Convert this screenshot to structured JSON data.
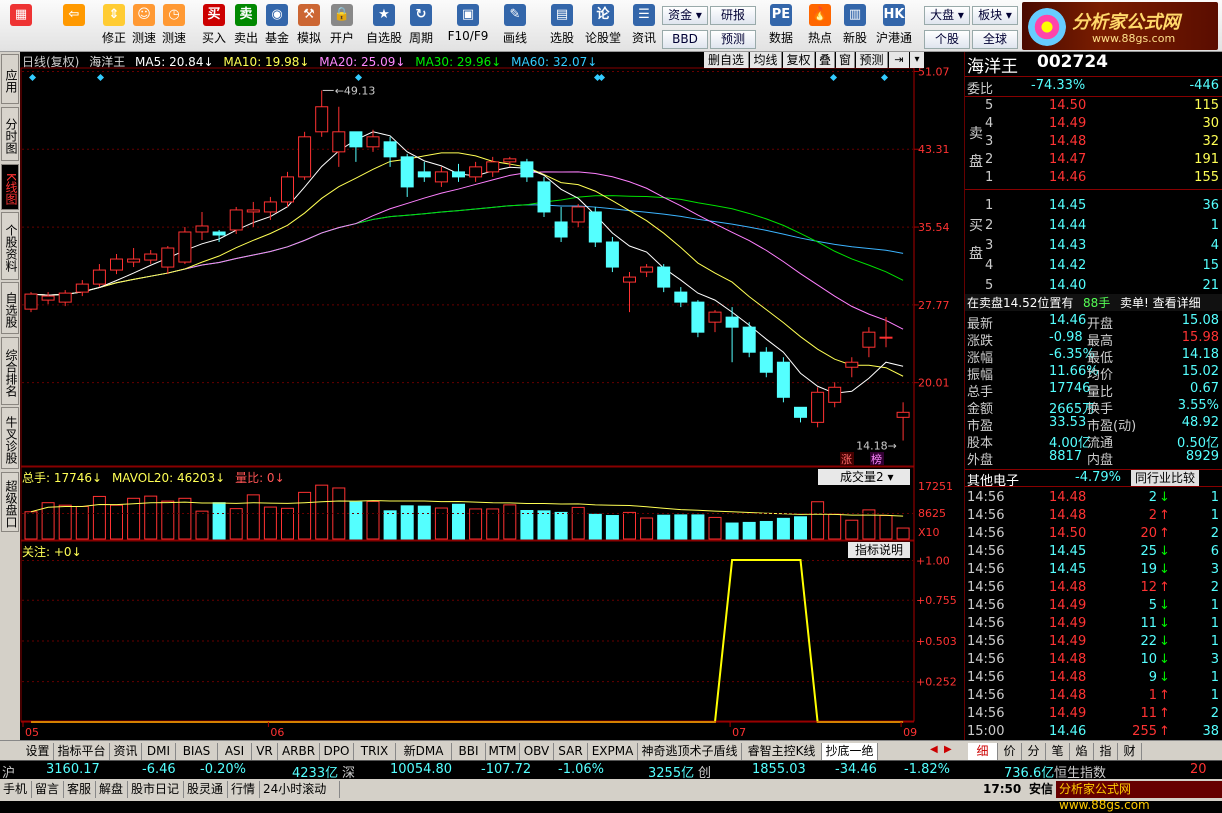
{
  "toolbar": {
    "buttons": [
      {
        "label": "",
        "icon": "grid-icon"
      },
      {
        "label": "",
        "icon": "back-arrow-icon"
      },
      {
        "label": "修正",
        "icon": "up-down-icon"
      },
      {
        "label": "测速",
        "icon": "speed-icon"
      },
      {
        "label": "测速",
        "icon": "clock-icon"
      },
      {
        "label": "买入",
        "icon": "buy-icon"
      },
      {
        "label": "卖出",
        "icon": "sell-icon"
      },
      {
        "label": "基金",
        "icon": "fund-icon"
      },
      {
        "label": "模拟",
        "icon": "hammer-icon"
      },
      {
        "label": "开户",
        "icon": "lock-icon"
      },
      {
        "label": "自选股",
        "icon": "star-icon"
      },
      {
        "label": "周期",
        "icon": "cycle-icon"
      },
      {
        "label": "F10/F9",
        "icon": "chart-icon"
      },
      {
        "label": "画线",
        "icon": "pen-icon"
      },
      {
        "label": "选股",
        "icon": "select-icon"
      },
      {
        "label": "论股堂",
        "icon": "forum-icon"
      },
      {
        "label": "资讯",
        "icon": "news-icon"
      },
      {
        "label": "数据",
        "icon": "pe-icon"
      },
      {
        "label": "热点",
        "icon": "hot-icon"
      },
      {
        "label": "新股",
        "icon": "newstock-icon"
      },
      {
        "label": "沪港通",
        "icon": "hkconnect-icon"
      }
    ],
    "small_buttons": [
      "资金",
      "BBD",
      "研报",
      "预测",
      "大盘",
      "个股",
      "板块",
      "全球"
    ]
  },
  "logo": {
    "title": "分析家公式网",
    "url": "www.88gs.com"
  },
  "left_tabs": [
    "应用",
    "分时图",
    "K线图",
    "个股资料",
    "自选股",
    "综合排名",
    "牛叉诊股",
    "超级盘口"
  ],
  "chart_header": {
    "period": "日线(复权)",
    "name": "海洋王",
    "ma5": "MA5: 20.84",
    "ma10": "MA10: 19.98",
    "ma20": "MA20: 25.09",
    "ma30": "MA30: 29.96",
    "ma60": "MA60: 32.07"
  },
  "chart_tools": [
    "删自选",
    "均线",
    "复权",
    "叠",
    "窗",
    "预测"
  ],
  "price_axis": [
    "51.07",
    "43.31",
    "35.54",
    "27.77",
    "20.01"
  ],
  "price_labels": {
    "high": "49.13",
    "low": "14.18"
  },
  "badges": [
    "涨",
    "榜"
  ],
  "volume_header": {
    "total": "总手: 17746",
    "mavol": "MAVOL20: 46203",
    "ratio": "量比: 0"
  },
  "volume_axis": [
    "17251",
    "8625",
    "X10"
  ],
  "volume_selector": "成交量2",
  "indicator_header": "关注: +0",
  "indicator_button": "指标说明",
  "indicator_axis": [
    "+1.00",
    "+0.755",
    "+0.503",
    "+0.252"
  ],
  "date_axis": [
    "05",
    "06",
    "07",
    "09"
  ],
  "colors": {
    "up": "#ff3232",
    "down": "#54ffff",
    "ma5": "#ffffff",
    "ma10": "#ffff54",
    "ma20": "#ff80ff",
    "ma30": "#00e000",
    "ma60": "#3cb4ff",
    "indicator": "#ffff00"
  },
  "chart_data": {
    "type": "candlestick",
    "candles": [
      [
        27.3,
        28.8,
        27.0,
        29.0
      ],
      [
        28.2,
        28.6,
        27.8,
        29.0
      ],
      [
        28.0,
        28.9,
        27.6,
        29.2
      ],
      [
        29.0,
        29.8,
        28.6,
        30.2
      ],
      [
        29.8,
        31.2,
        29.5,
        31.8
      ],
      [
        31.2,
        32.3,
        30.8,
        32.8
      ],
      [
        32.0,
        32.3,
        31.5,
        33.4
      ],
      [
        32.2,
        32.8,
        31.8,
        33.2
      ],
      [
        31.5,
        33.4,
        30.8,
        33.6
      ],
      [
        32.0,
        35.0,
        31.8,
        35.5
      ],
      [
        35.0,
        35.6,
        34.2,
        37.0
      ],
      [
        35.0,
        34.7,
        34.0,
        35.2
      ],
      [
        35.2,
        37.2,
        34.8,
        37.5
      ],
      [
        37.0,
        37.2,
        35.5,
        38.0
      ],
      [
        37.0,
        38.0,
        36.2,
        38.5
      ],
      [
        38.0,
        40.5,
        37.5,
        41.0
      ],
      [
        40.5,
        44.5,
        40.2,
        45.0
      ],
      [
        45.0,
        47.5,
        44.5,
        49.13
      ],
      [
        43.0,
        45.0,
        41.5,
        47.5
      ],
      [
        45.0,
        43.5,
        42.0,
        44.5
      ],
      [
        43.5,
        44.5,
        43.0,
        45.2
      ],
      [
        44.0,
        42.5,
        41.5,
        44.5
      ],
      [
        42.5,
        39.5,
        38.5,
        42.8
      ],
      [
        41.0,
        40.5,
        40.0,
        42.0
      ],
      [
        40.0,
        41.0,
        39.5,
        41.5
      ],
      [
        41.0,
        40.5,
        40.0,
        41.8
      ],
      [
        40.5,
        41.5,
        40.0,
        42.0
      ],
      [
        41.0,
        42.0,
        40.5,
        42.5
      ],
      [
        42.0,
        42.3,
        41.5,
        42.5
      ],
      [
        42.0,
        40.5,
        40.0,
        42.3
      ],
      [
        40.0,
        37.0,
        36.5,
        40.5
      ],
      [
        36.0,
        34.5,
        34.0,
        37.5
      ],
      [
        36.0,
        37.5,
        35.5,
        37.8
      ],
      [
        37.0,
        34.0,
        33.5,
        37.5
      ],
      [
        34.0,
        31.5,
        31.0,
        34.5
      ],
      [
        30.0,
        30.5,
        27.0,
        31.0
      ],
      [
        31.0,
        31.5,
        30.5,
        31.8
      ],
      [
        31.5,
        29.5,
        29.0,
        31.8
      ],
      [
        29.0,
        28.0,
        27.5,
        29.5
      ],
      [
        28.0,
        25.0,
        24.5,
        28.2
      ],
      [
        26.0,
        27.0,
        25.0,
        27.2
      ],
      [
        26.5,
        25.5,
        22.0,
        27.5
      ],
      [
        25.5,
        23.0,
        22.5,
        26.0
      ],
      [
        23.0,
        21.0,
        20.5,
        23.5
      ],
      [
        22.0,
        18.5,
        18.0,
        22.5
      ],
      [
        17.5,
        16.5,
        16.0,
        17.5
      ],
      [
        16.0,
        19.0,
        15.5,
        19.5
      ],
      [
        18.0,
        19.5,
        17.5,
        20.0
      ],
      [
        21.5,
        22.0,
        20.5,
        22.5
      ],
      [
        23.5,
        25.0,
        22.5,
        25.5
      ],
      [
        24.5,
        24.5,
        23.5,
        26.5
      ],
      [
        16.5,
        17.0,
        14.18,
        18.0
      ]
    ],
    "volume": [
      8.7,
      11.6,
      10.8,
      10.4,
      13.6,
      10.8,
      13.0,
      13.7,
      12.1,
      13.0,
      8.9,
      11.6,
      9.7,
      14.1,
      10.2,
      9.8,
      14.9,
      17.2,
      16.3,
      11.8,
      12.0,
      9.0,
      10.6,
      10.5,
      9.9,
      11.1,
      9.6,
      9.6,
      10.9,
      9.1,
      9.0,
      8.5,
      10.1,
      7.9,
      7.5,
      8.5,
      6.7,
      7.6,
      7.7,
      7.7,
      6.9,
      5.1,
      5.3,
      5.6,
      6.6,
      7.1,
      11.9,
      7.9,
      6.0,
      9.3,
      7.5,
      3.5
    ],
    "indicator": [
      0,
      0,
      0,
      0,
      0,
      0,
      0,
      0,
      0,
      0,
      0,
      0,
      0,
      0,
      0,
      0,
      0,
      0,
      0,
      0,
      0,
      0,
      0,
      0,
      0,
      0,
      0,
      0,
      0,
      0,
      0,
      0,
      0,
      0,
      0,
      0,
      0,
      0,
      0,
      0,
      0,
      1,
      1,
      1,
      1,
      1,
      0,
      0,
      0,
      0,
      0,
      0
    ]
  },
  "quote": {
    "name": "海洋王",
    "code": "002724",
    "weibi_label": "委比",
    "weibi": "-74.33%",
    "weicha": "-446",
    "sell_label": "卖盘",
    "buy_label": "买盘",
    "asks": [
      [
        "5",
        "14.50",
        "115"
      ],
      [
        "4",
        "14.49",
        "30"
      ],
      [
        "3",
        "14.48",
        "32"
      ],
      [
        "2",
        "14.47",
        "191"
      ],
      [
        "1",
        "14.46",
        "155"
      ]
    ],
    "bids": [
      [
        "1",
        "14.45",
        "36"
      ],
      [
        "2",
        "14.44",
        "1"
      ],
      [
        "3",
        "14.43",
        "4"
      ],
      [
        "4",
        "14.42",
        "15"
      ],
      [
        "5",
        "14.40",
        "21"
      ]
    ],
    "notice": "在卖盘14.52位置有",
    "notice_count": "88手",
    "notice_link": "卖单! 查看详细",
    "stats": [
      [
        "最新",
        "14.46",
        "开盘",
        "15.08"
      ],
      [
        "涨跌",
        "-0.98",
        "最高",
        "15.98"
      ],
      [
        "涨幅",
        "-6.35%",
        "最低",
        "14.18"
      ],
      [
        "振幅",
        "11.66%",
        "均价",
        "15.02"
      ],
      [
        "总手",
        "17746",
        "量比",
        "0.67"
      ],
      [
        "金额",
        "2665万",
        "换手",
        "3.55%"
      ],
      [
        "市盈",
        "33.53",
        "市盈(动)",
        "48.92"
      ],
      [
        "股本",
        "4.00亿",
        "流通",
        "0.50亿"
      ],
      [
        "外盘",
        "8817",
        "内盘",
        "8929"
      ]
    ],
    "sector": "其他电子",
    "sector_change": "-4.79%",
    "sector_button": "同行业比较",
    "ticks": [
      [
        "14:56",
        "14.48",
        "2",
        "d",
        "1"
      ],
      [
        "14:56",
        "14.48",
        "2",
        "u",
        "1"
      ],
      [
        "14:56",
        "14.50",
        "20",
        "u",
        "2"
      ],
      [
        "14:56",
        "14.45",
        "25",
        "d",
        "6"
      ],
      [
        "14:56",
        "14.45",
        "19",
        "d",
        "3"
      ],
      [
        "14:56",
        "14.48",
        "12",
        "u",
        "2"
      ],
      [
        "14:56",
        "14.49",
        "5",
        "d",
        "1"
      ],
      [
        "14:56",
        "14.49",
        "11",
        "d",
        "1"
      ],
      [
        "14:56",
        "14.49",
        "22",
        "d",
        "1"
      ],
      [
        "14:56",
        "14.48",
        "10",
        "d",
        "3"
      ],
      [
        "14:56",
        "14.48",
        "9",
        "d",
        "1"
      ],
      [
        "14:56",
        "14.48",
        "1",
        "u",
        "1"
      ],
      [
        "14:56",
        "14.49",
        "11",
        "u",
        "2"
      ],
      [
        "15:00",
        "14.46",
        "255",
        "u",
        "38"
      ]
    ],
    "tabs": [
      "细",
      "价",
      "分",
      "笔",
      "焰",
      "指",
      "财"
    ]
  },
  "bottom_tabs": [
    "设置",
    "指标平台",
    "资讯",
    "DMI",
    "BIAS",
    "ASI",
    "VR",
    "ARBR",
    "DPO",
    "TRIX",
    "新DMA",
    "BBI",
    "MTM",
    "OBV",
    "SAR",
    "EXPMA",
    "神奇逃顶术子盾线",
    "睿智主控K线",
    "抄底一绝"
  ],
  "index_bar": {
    "sh_label": "沪",
    "sh": "3160.17",
    "sh_chg": "-6.46",
    "sh_pct": "-0.20%",
    "sh_amt": "4233亿",
    "sz_label": "深",
    "sz": "10054.80",
    "sz_chg": "-107.72",
    "sz_pct": "-1.06%",
    "sz_amt": "3255亿",
    "cy_label": "创",
    "cy": "1855.03",
    "cy_chg": "-34.46",
    "cy_pct": "-1.82%",
    "hs_amt": "736.6亿",
    "hs_label": "恒生指数",
    "hs": "20"
  },
  "status_bar": [
    "手机",
    "留言",
    "客服",
    "解盘",
    "股市日记",
    "股灵通",
    "行情",
    "24小时滚动"
  ],
  "status_right": {
    "url": "分析家公式网 www.88gs.com",
    "time": "17:50",
    "org": "安信"
  }
}
